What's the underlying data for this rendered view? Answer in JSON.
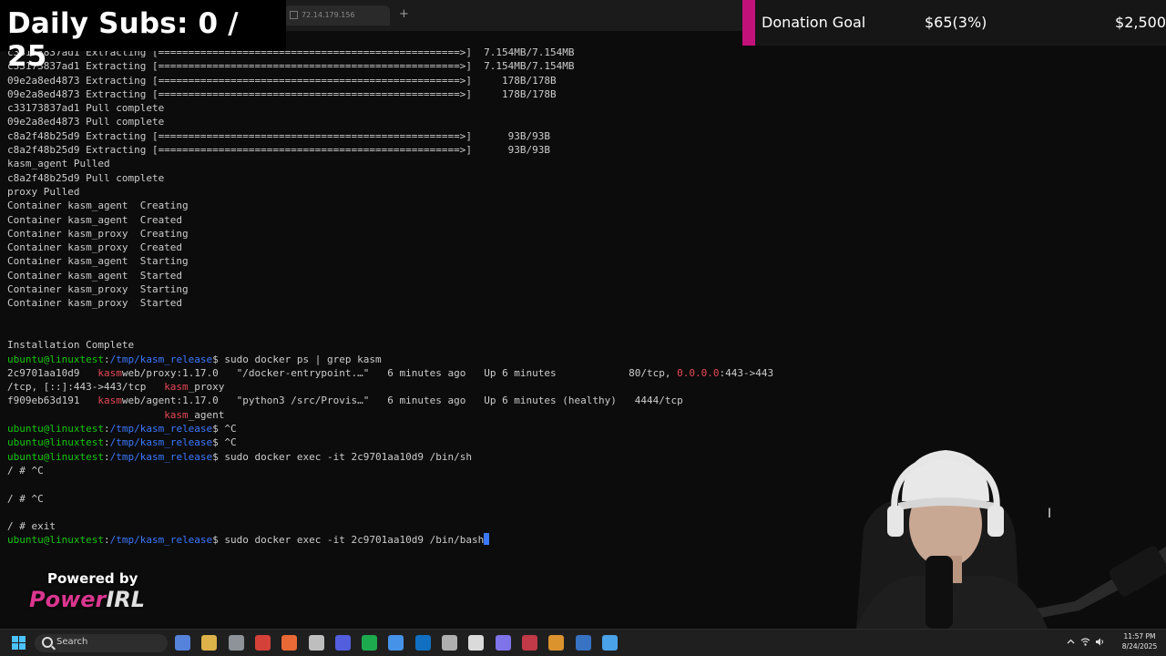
{
  "overlay": {
    "daily_subs": "Daily Subs: 0 / 25",
    "donation_label": "Donation Goal",
    "donation_amount": "$65(3%)",
    "donation_target": "$2,500",
    "donation_progress_percent": 3,
    "powered_by": "Powered by",
    "brand_part1": "Power",
    "brand_part2": "IRL"
  },
  "terminal": {
    "tab_title": "72.14.179.156",
    "new_tab_symbol": "+",
    "prompt_user": "ubuntu@linuxtest",
    "prompt_path": "/tmp/kasm_release",
    "lines": [
      [
        {
          "t": "c33173837ad1 Extracting [==================================================>]  7.154MB/7.154MB"
        }
      ],
      [
        {
          "t": "c33173837ad1 Extracting [==================================================>]  7.154MB/7.154MB"
        }
      ],
      [
        {
          "t": "09e2a8ed4873 Extracting [==================================================>]     178B/178B"
        }
      ],
      [
        {
          "t": "09e2a8ed4873 Extracting [==================================================>]     178B/178B"
        }
      ],
      [
        {
          "t": "c33173837ad1 Pull complete"
        }
      ],
      [
        {
          "t": "09e2a8ed4873 Pull complete"
        }
      ],
      [
        {
          "t": "c8a2f48b25d9 Extracting [==================================================>]      93B/93B"
        }
      ],
      [
        {
          "t": "c8a2f48b25d9 Extracting [==================================================>]      93B/93B"
        }
      ],
      [
        {
          "t": "kasm_agent Pulled"
        }
      ],
      [
        {
          "t": "c8a2f48b25d9 Pull complete"
        }
      ],
      [
        {
          "t": "proxy Pulled"
        }
      ],
      [
        {
          "t": "Container kasm_agent  Creating"
        }
      ],
      [
        {
          "t": "Container kasm_agent  Created"
        }
      ],
      [
        {
          "t": "Container kasm_proxy  Creating"
        }
      ],
      [
        {
          "t": "Container kasm_proxy  Created"
        }
      ],
      [
        {
          "t": "Container kasm_agent  Starting"
        }
      ],
      [
        {
          "t": "Container kasm_agent  Started"
        }
      ],
      [
        {
          "t": "Container kasm_proxy  Starting"
        }
      ],
      [
        {
          "t": "Container kasm_proxy  Started"
        }
      ],
      [
        {
          "t": ""
        }
      ],
      [
        {
          "t": ""
        }
      ],
      [
        {
          "t": "Installation Complete"
        }
      ],
      [
        {
          "t": "ubuntu@linuxtest",
          "c": "g"
        },
        {
          "t": ":"
        },
        {
          "t": "/tmp/kasm_release",
          "c": "b"
        },
        {
          "t": "$ sudo docker ps | grep kasm"
        }
      ],
      [
        {
          "t": "2c9701aa10d9   "
        },
        {
          "t": "kasm",
          "c": "r"
        },
        {
          "t": "web/proxy:1.17.0   \"/docker-entrypoint.…\"   6 minutes ago   Up 6 minutes            80/tcp, "
        },
        {
          "t": "0.0.0.0",
          "c": "r"
        },
        {
          "t": ":443->443"
        }
      ],
      [
        {
          "t": "/tcp, [::]:443->443/tcp   "
        },
        {
          "t": "kasm",
          "c": "r"
        },
        {
          "t": "_proxy"
        }
      ],
      [
        {
          "t": "f909eb63d191   "
        },
        {
          "t": "kasm",
          "c": "r"
        },
        {
          "t": "web/agent:1.17.0   \"python3 /src/Provis…\"   6 minutes ago   Up 6 minutes (healthy)   4444/tcp"
        }
      ],
      [
        {
          "t": "                          "
        },
        {
          "t": "kasm",
          "c": "r"
        },
        {
          "t": "_agent"
        }
      ],
      [
        {
          "t": "ubuntu@linuxtest",
          "c": "g"
        },
        {
          "t": ":"
        },
        {
          "t": "/tmp/kasm_release",
          "c": "b"
        },
        {
          "t": "$ ^C"
        }
      ],
      [
        {
          "t": "ubuntu@linuxtest",
          "c": "g"
        },
        {
          "t": ":"
        },
        {
          "t": "/tmp/kasm_release",
          "c": "b"
        },
        {
          "t": "$ ^C"
        }
      ],
      [
        {
          "t": "ubuntu@linuxtest",
          "c": "g"
        },
        {
          "t": ":"
        },
        {
          "t": "/tmp/kasm_release",
          "c": "b"
        },
        {
          "t": "$ sudo docker exec -it 2c9701aa10d9 /bin/sh"
        }
      ],
      [
        {
          "t": "/ # ^C"
        }
      ],
      [
        {
          "t": ""
        }
      ],
      [
        {
          "t": "/ # ^C"
        }
      ],
      [
        {
          "t": ""
        }
      ],
      [
        {
          "t": "/ # exit"
        }
      ],
      [
        {
          "t": "ubuntu@linuxtest",
          "c": "g"
        },
        {
          "t": ":"
        },
        {
          "t": "/tmp/kasm_release",
          "c": "b"
        },
        {
          "t": "$ sudo docker exec -it 2c9701aa10d9 /bin/bash"
        }
      ]
    ]
  },
  "taskbar": {
    "search_placeholder": "Search",
    "time": "11:57 PM",
    "date": "8/24/2025",
    "apps": [
      {
        "name": "copilot-icon",
        "color": "#5b8def"
      },
      {
        "name": "file-explorer-icon",
        "color": "#f2c14e"
      },
      {
        "name": "settings-icon",
        "color": "#9aa0a6"
      },
      {
        "name": "chrome-icon",
        "color": "#e8453c"
      },
      {
        "name": "firefox-icon",
        "color": "#ff7139"
      },
      {
        "name": "openai-icon",
        "color": "#cfcfcf"
      },
      {
        "name": "discord-icon",
        "color": "#5865f2"
      },
      {
        "name": "spotify-icon",
        "color": "#1db954"
      },
      {
        "name": "terminal-icon",
        "color": "#4a9eff"
      },
      {
        "name": "outlook-icon",
        "color": "#0f78d4"
      },
      {
        "name": "mail-icon",
        "color": "#bfbfbf"
      },
      {
        "name": "notion-icon",
        "color": "#eeeeee"
      },
      {
        "name": "photos-icon",
        "color": "#8a7cff"
      },
      {
        "name": "vpn-icon",
        "color": "#d43c4c"
      },
      {
        "name": "chrome-dev-icon",
        "color": "#f0a030"
      },
      {
        "name": "media-icon",
        "color": "#3a7bd5"
      },
      {
        "name": "calculator-icon",
        "color": "#4fb0ff"
      }
    ]
  }
}
